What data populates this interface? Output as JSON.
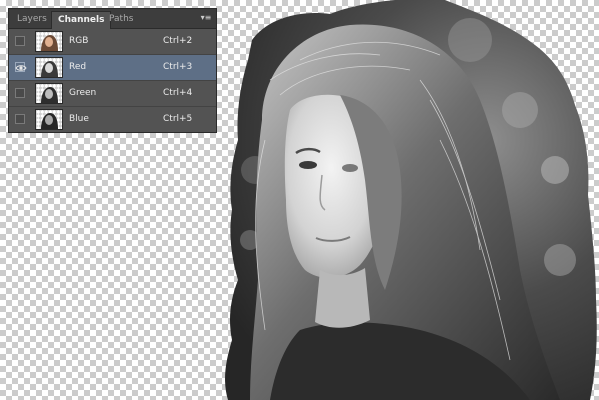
{
  "panel": {
    "tabs": [
      {
        "label": "Layers",
        "active": false
      },
      {
        "label": "Channels",
        "active": true
      },
      {
        "label": "Paths",
        "active": false
      }
    ],
    "menu_icon": "panel-menu-icon",
    "channels": [
      {
        "name": "RGB",
        "shortcut": "Ctrl+2",
        "visible": false,
        "selected": false
      },
      {
        "name": "Red",
        "shortcut": "Ctrl+3",
        "visible": true,
        "selected": true
      },
      {
        "name": "Green",
        "shortcut": "Ctrl+4",
        "visible": false,
        "selected": false
      },
      {
        "name": "Blue",
        "shortcut": "Ctrl+5",
        "visible": false,
        "selected": false
      }
    ]
  },
  "colors": {
    "panel_bg": "#535353",
    "tab_bg": "#3d3d3d",
    "selection": "#5e6f86",
    "checker_dark": "#cccccc"
  }
}
